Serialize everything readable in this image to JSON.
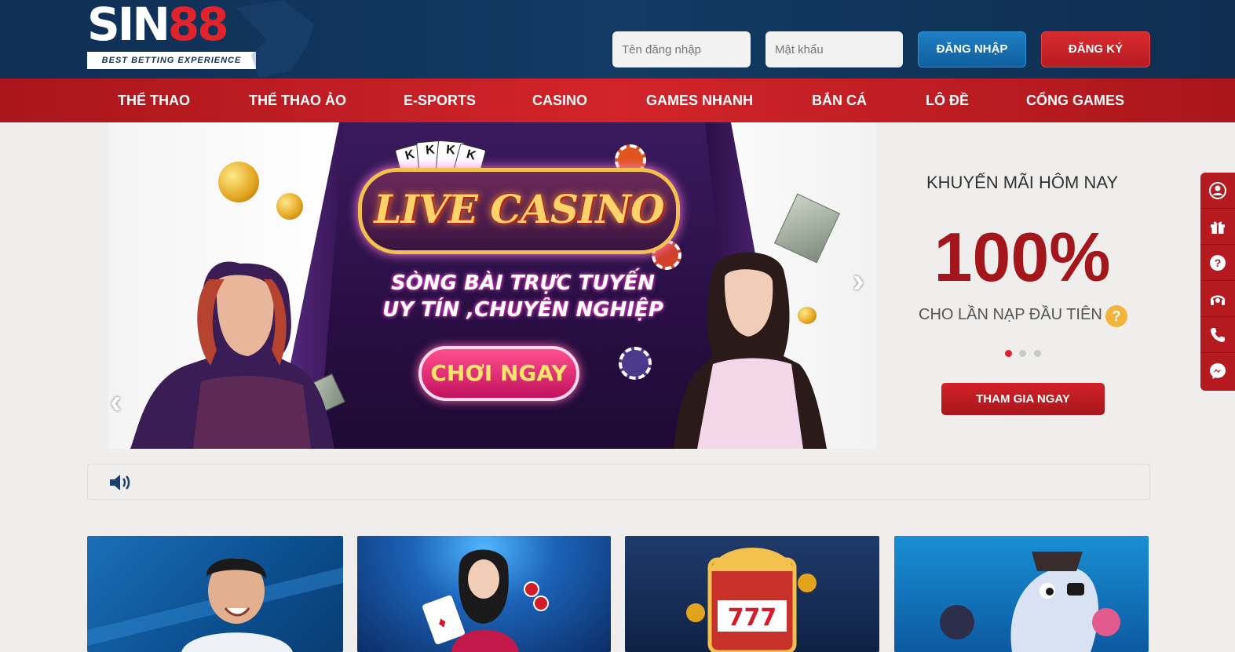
{
  "header": {
    "logo": {
      "word_white": "SIN",
      "word_red": "88",
      "tagline": "BEST BETTING EXPERIENCE"
    },
    "username_placeholder": "Tên đăng nhập",
    "password_placeholder": "Mật khẩu",
    "login_label": "ĐĂNG NHẬP",
    "register_label": "ĐĂNG KÝ"
  },
  "nav": {
    "items": [
      {
        "label": "THỂ THAO"
      },
      {
        "label": "THỂ THAO ẢO"
      },
      {
        "label": "E-SPORTS"
      },
      {
        "label": "CASINO"
      },
      {
        "label": "GAMES NHANH"
      },
      {
        "label": "BẮN CÁ"
      },
      {
        "label": "LÔ ĐỀ"
      },
      {
        "label": "CỔNG GAMES"
      }
    ]
  },
  "banner": {
    "title": "LIVE CASINO",
    "subtitle_line1": "SÒNG BÀI TRỰC TUYẾN",
    "subtitle_line2": "UY TÍN ,CHUYÊN NGHIỆP",
    "cta": "CHƠI NGAY",
    "card_letter": "K",
    "prev_icon": "chevron-left-icon",
    "next_icon": "chevron-right-icon"
  },
  "promo": {
    "title": "KHUYẾN MÃI HÔM NAY",
    "percent": "100%",
    "description": "CHO LẦN NẠP ĐẦU TIÊN",
    "help": "?",
    "join_label": "THAM GIA NGAY",
    "active_slide": 1,
    "slide_count": 3
  },
  "side_menu": {
    "icons": [
      "user-icon",
      "gift-icon",
      "help-icon",
      "support-headset-icon",
      "phone-icon",
      "messenger-icon"
    ]
  },
  "marquee": {
    "icon": "speaker-icon",
    "text": ""
  },
  "colors": {
    "header_bg": "#0f2f55",
    "nav_red": "#c61f25",
    "promo_red": "#a3161b",
    "login_blue": "#1670b3"
  }
}
